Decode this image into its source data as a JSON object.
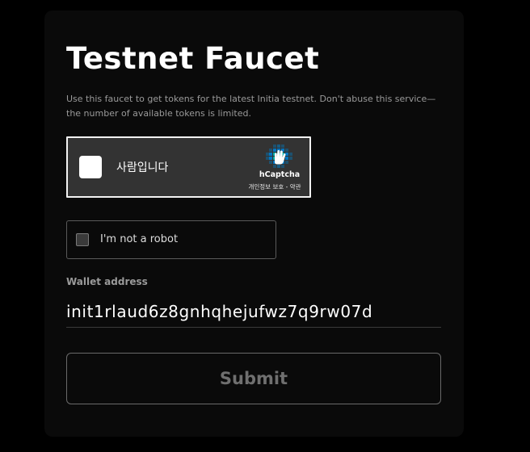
{
  "page": {
    "title": "Testnet Faucet",
    "description": "Use this faucet to get tokens for the latest Initia testnet. Don't abuse this service—the number of available tokens is limited."
  },
  "hcaptcha": {
    "label": "사람입니다",
    "brand": "hCaptcha",
    "links": "개인정보 보호 - 약관",
    "logo_icon": "hcaptcha-hand-icon",
    "checked": false
  },
  "robot_check": {
    "label": "I'm not a robot",
    "checked": false
  },
  "wallet": {
    "label": "Wallet address",
    "value": "init1rlaud6z8gnhqhejufwz7q9rw07d"
  },
  "submit": {
    "label": "Submit",
    "enabled": false
  },
  "colors": {
    "background": "#000000",
    "card": "#0a0a0a",
    "text_primary": "#ffffff",
    "text_secondary": "#9a9a9a",
    "hcaptcha_bg": "#333333",
    "hcaptcha_logo": "#0074bf",
    "hcaptcha_logo_accent": "#00a9a4",
    "submit_disabled_text": "#6f6f6f"
  }
}
